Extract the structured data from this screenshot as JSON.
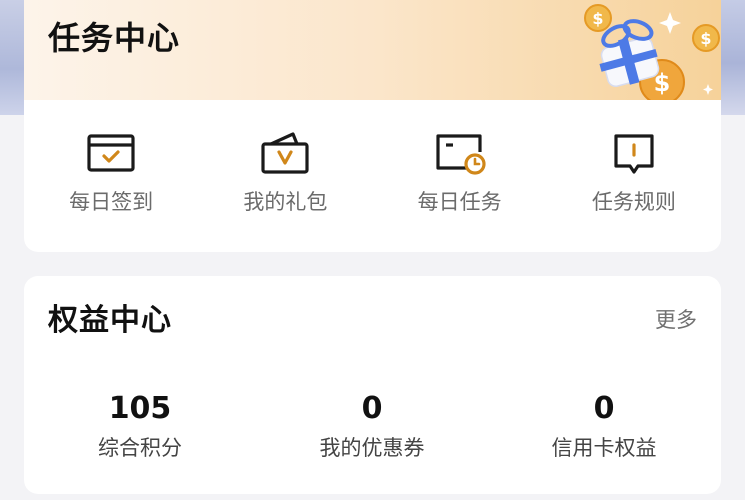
{
  "task_center": {
    "title": "任务中心",
    "items": [
      {
        "label": "每日签到",
        "icon": "calendar-check-icon"
      },
      {
        "label": "我的礼包",
        "icon": "gift-bag-icon"
      },
      {
        "label": "每日任务",
        "icon": "task-clock-icon"
      },
      {
        "label": "任务规则",
        "icon": "rule-book-icon"
      }
    ]
  },
  "rights_center": {
    "title": "权益中心",
    "more_label": "更多",
    "stats": [
      {
        "value": "105",
        "label": "综合积分"
      },
      {
        "value": "0",
        "label": "我的优惠券"
      },
      {
        "value": "0",
        "label": "信用卡权益"
      }
    ]
  },
  "colors": {
    "accent": "#d0871a",
    "header_gradient_start": "#fdf4ea",
    "header_gradient_end": "#f6d29a",
    "text_primary": "#111111",
    "text_secondary": "#6b6b6b"
  }
}
